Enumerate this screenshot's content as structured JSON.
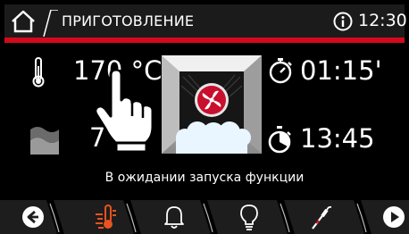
{
  "header": {
    "title": "ПРИГОТОВЛЕНИЕ",
    "clock": "12:30",
    "accent_color": "#d4091c"
  },
  "main": {
    "temperature": {
      "icon": "thermometer-icon",
      "value": "170 °C"
    },
    "humidity": {
      "icon": "steam-icon",
      "value": "7"
    },
    "cook_time": {
      "icon": "timer-icon",
      "value": "01:15'"
    },
    "end_time": {
      "icon": "end-time-icon",
      "value": "13:45"
    },
    "oven_icon": "oven-fan-icon",
    "status": "В ожидании запуска функции"
  },
  "nav": {
    "items": [
      {
        "icon": "back-icon"
      },
      {
        "icon": "temperature-mode-icon"
      },
      {
        "icon": "bell-icon"
      },
      {
        "icon": "light-bulb-icon"
      },
      {
        "icon": "probe-icon"
      },
      {
        "icon": "play-icon"
      }
    ]
  }
}
